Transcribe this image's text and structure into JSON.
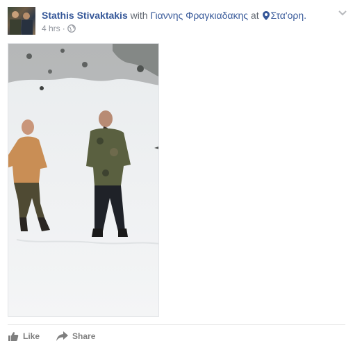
{
  "post": {
    "author": "Stathis Stivaktakis",
    "with_text": "with",
    "tagged": "Γιαννης Φραγκιαδακης",
    "at_text": "at",
    "place": "Στα'ορη.",
    "time": "4 hrs",
    "separator": "·",
    "privacy_icon": "globe-icon",
    "menu_icon": "chevron-down-icon"
  },
  "actions": {
    "like_label": "Like",
    "share_label": "Share",
    "like_icon": "thumbs-up-icon",
    "share_icon": "share-arrow-icon"
  },
  "colors": {
    "link": "#365899",
    "muted": "#90949c",
    "action": "#7f7f7f"
  }
}
